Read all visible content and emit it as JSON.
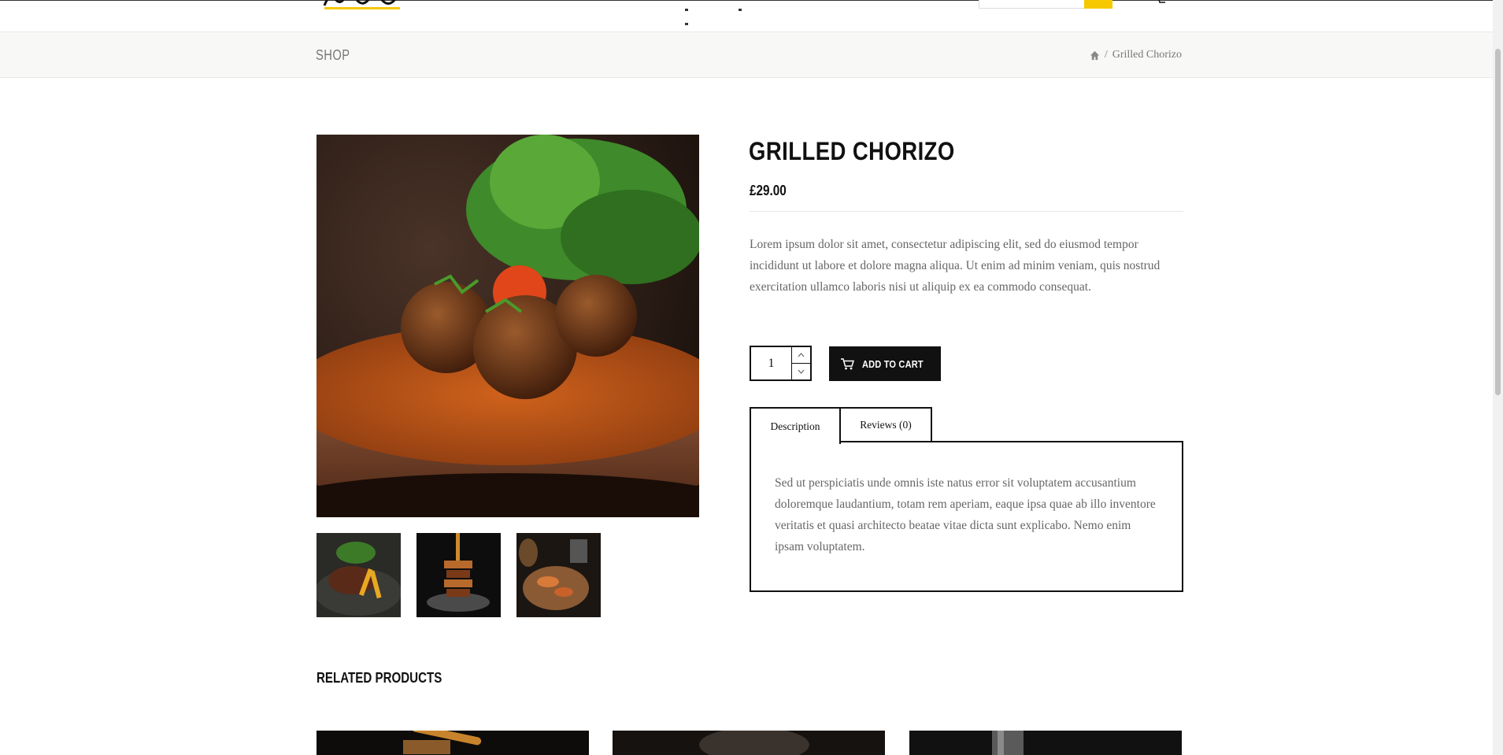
{
  "header": {
    "search_placeholder": ""
  },
  "breadcrumb_bar": {
    "page_title": "SHOP",
    "separator": "/",
    "current": "Grilled Chorizo"
  },
  "product": {
    "title": "GRILLED CHORIZO",
    "price": "£29.00",
    "short_description": "Lorem ipsum dolor sit amet, consectetur adipiscing elit, sed do eiusmod tempor incididunt ut labore et dolore magna aliqua. Ut enim ad minim veniam, quis nostrud exercitation ullamco laboris nisi ut aliquip ex ea commodo consequat.",
    "quantity": "1",
    "add_to_cart_label": "ADD TO CART"
  },
  "tabs": [
    {
      "label": "Description",
      "active": true
    },
    {
      "label": "Reviews (0)",
      "active": false
    }
  ],
  "tab_panel": {
    "description_text": "Sed ut perspiciatis unde omnis iste natus error sit voluptatem accusantium doloremque laudantium, totam rem aperiam, eaque ipsa quae ab illo inventore veritatis et quasi architecto beatae vitae dicta sunt explicabo. Nemo enim ipsam voluptatem."
  },
  "related": {
    "title": "RELATED PRODUCTS"
  },
  "colors": {
    "accent": "#f5c800",
    "button_bg": "#111111",
    "crumb_bg": "#f8f8f6",
    "body_text": "#666666"
  },
  "icons": {
    "home": "home-icon",
    "cart": "cart-icon",
    "arrow_up": "chevron-up-icon",
    "arrow_down": "chevron-down-icon"
  }
}
